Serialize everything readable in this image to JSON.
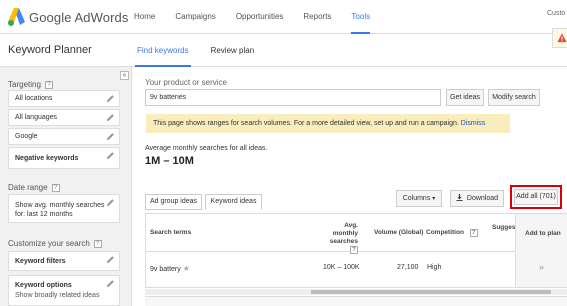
{
  "app": {
    "brand": "Google AdWords",
    "customer_text": "Custo"
  },
  "topnav": [
    {
      "label": "Home"
    },
    {
      "label": "Campaigns"
    },
    {
      "label": "Opportunities"
    },
    {
      "label": "Reports"
    },
    {
      "label": "Tools",
      "active": true
    }
  ],
  "subbar": {
    "title": "Keyword Planner",
    "tabs": [
      {
        "label": "Find keywords",
        "active": true
      },
      {
        "label": "Review plan"
      }
    ]
  },
  "sidebar": {
    "collapse_glyph": "«",
    "targeting": {
      "title": "Targeting",
      "items": [
        "All locations",
        "All languages",
        "Google",
        "Negative keywords"
      ]
    },
    "date_range": {
      "title": "Date range",
      "text_line1": "Show avg. monthly searches",
      "text_line2": "for: last 12 months"
    },
    "customize": {
      "title": "Customize your search",
      "items": [
        "Keyword filters",
        "Keyword options"
      ],
      "partial_text": "Show broadly related ideas"
    }
  },
  "main": {
    "product_label": "Your product or service",
    "product_value": "9v batteries",
    "get_ideas": "Get ideas",
    "modify_search": "Modify search",
    "notice_text": "This page shows ranges for search volumes. For a more detailed view, set up and run a campaign.",
    "notice_dismiss": "Dismiss",
    "avg_label": "Average monthly searches for all ideas.",
    "avg_value": "1M – 10M",
    "tabs": [
      "Ad group ideas",
      "Keyword ideas"
    ],
    "columns_btn": "Columns",
    "download_btn": "Download",
    "add_all_btn": "Add all (701)",
    "table": {
      "headers": {
        "search_terms": "Search terms",
        "avg_monthly_1": "Avg. monthly",
        "avg_monthly_2": "searches",
        "volume": "Volume (Global)",
        "competition": "Competition",
        "suggested": "Suggest",
        "add_to_plan": "Add to plan"
      },
      "rows": [
        {
          "term": "9v battery",
          "avg": "10K – 100K",
          "volume": "27,100",
          "competition": "High",
          "add": "»"
        }
      ]
    }
  },
  "colors": {
    "accent": "#3b78e7",
    "notice_bg": "#f9edbe",
    "highlight_border": "#dd0000",
    "logo_green": "#34a853",
    "logo_blue": "#4285f4",
    "logo_yellow": "#fbbc05"
  },
  "icons": [
    "adwords-logo-icon",
    "warning-icon",
    "pencil-icon",
    "help-icon",
    "star-icon",
    "download-icon",
    "dropdown-caret-icon"
  ]
}
